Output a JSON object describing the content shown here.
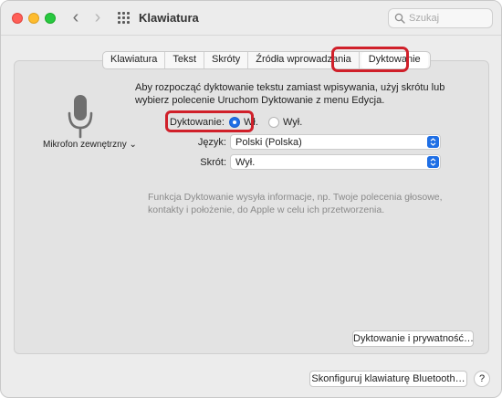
{
  "window": {
    "title": "Klawiatura"
  },
  "search": {
    "placeholder": "Szukaj"
  },
  "tabs": [
    {
      "label": "Klawiatura"
    },
    {
      "label": "Tekst"
    },
    {
      "label": "Skróty"
    },
    {
      "label": "Źródła wprowadzania"
    },
    {
      "label": "Dyktowanie",
      "active": true
    }
  ],
  "microphone": {
    "label": "Mikrofon zewnętrzny ⌄",
    "icon": "microphone-icon"
  },
  "description": "Aby rozpocząć dyktowanie tekstu zamiast wpisywania, użyj skrótu lub wybierz polecenie Uruchom Dyktowanie z menu Edycja.",
  "dictation": {
    "label": "Dyktowanie:",
    "on_label": "Wł.",
    "off_label": "Wył.",
    "selected": "on"
  },
  "language": {
    "label": "Język:",
    "value": "Polski (Polska)"
  },
  "shortcut": {
    "label": "Skrót:",
    "value": "Wył."
  },
  "privacy_note": "Funkcja Dyktowanie wysyła informacje, np. Twoje polecenia głosowe, kontakty i położenie, do Apple w celu ich przetworzenia.",
  "buttons": {
    "privacy": "Dyktowanie i prywatność…",
    "bluetooth": "Skonfiguruj klawiaturę Bluetooth…",
    "help": "?"
  },
  "colors": {
    "accent": "#1f6fe5",
    "highlight": "#d0202a"
  }
}
